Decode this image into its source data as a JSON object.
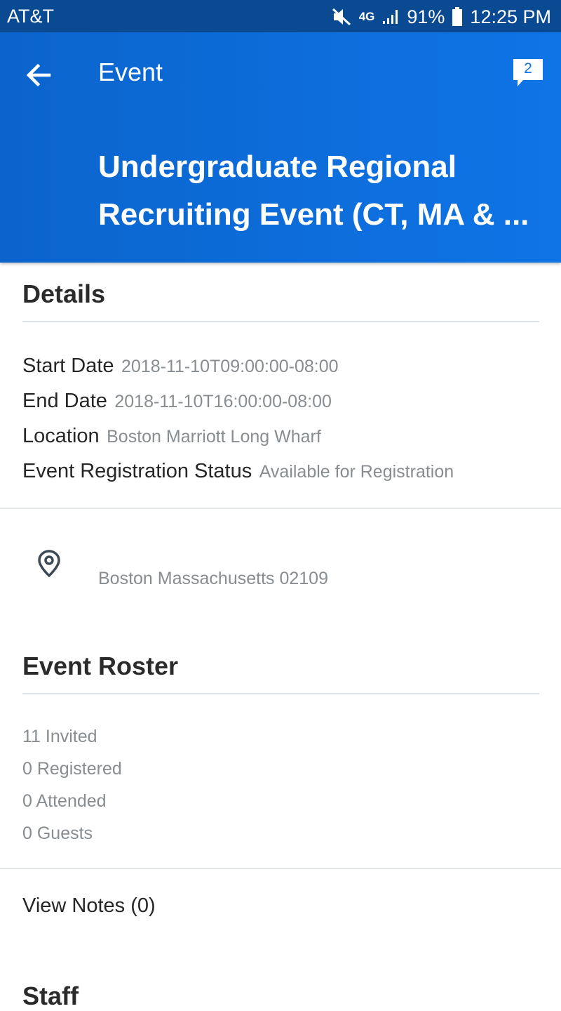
{
  "status_bar": {
    "carrier": "AT&T",
    "network": "4G",
    "battery": "91%",
    "time": "12:25 PM"
  },
  "header": {
    "back_icon": "arrow-left-icon",
    "title": "Event",
    "comments_icon": "comment-bubble-icon",
    "comments_count": "2",
    "event_title_line1": "Undergraduate Regional",
    "event_title_line2": "Recruiting Event (CT, MA & ..."
  },
  "details": {
    "heading": "Details",
    "rows": [
      {
        "label": "Start Date",
        "value": "2018-11-10T09:00:00-08:00"
      },
      {
        "label": "End Date",
        "value": "2018-11-10T16:00:00-08:00"
      },
      {
        "label": "Location",
        "value": "Boston Marriott Long Wharf"
      },
      {
        "label": "Event Registration Status",
        "value": "Available for Registration"
      }
    ]
  },
  "address": {
    "icon": "location-pin-icon",
    "text": "Boston Massachusetts 02109"
  },
  "roster": {
    "heading": "Event Roster",
    "items": [
      "11 Invited",
      "0 Registered",
      "0 Attended",
      "0 Guests"
    ]
  },
  "notes": {
    "label": "View Notes (0)"
  },
  "staff": {
    "heading": "Staff"
  },
  "colors": {
    "header_blue": "#0f74e6",
    "status_bar": "#0a4a93",
    "muted_text": "#888d92"
  }
}
